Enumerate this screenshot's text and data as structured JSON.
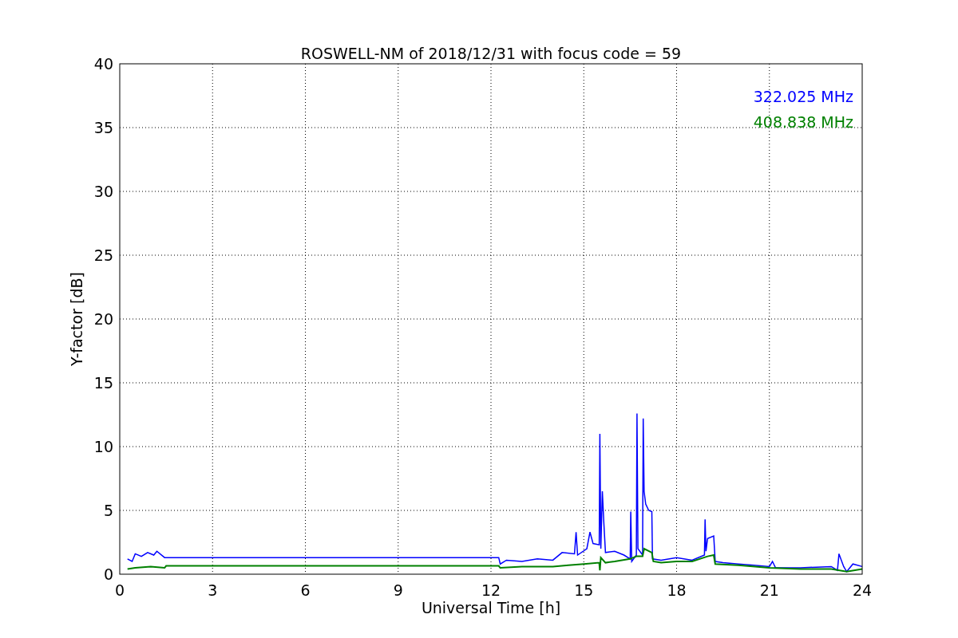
{
  "chart_data": {
    "type": "line",
    "title": "ROSWELL-NM of 2018/12/31 with focus code = 59",
    "xlabel": "Universal Time [h]",
    "ylabel": "Y-factor [dB]",
    "xlim": [
      0,
      24
    ],
    "ylim": [
      0,
      40
    ],
    "xticks": [
      0,
      3,
      6,
      9,
      12,
      15,
      18,
      21,
      24
    ],
    "yticks": [
      0,
      5,
      10,
      15,
      20,
      25,
      30,
      35,
      40
    ],
    "grid": true,
    "series": [
      {
        "name": "322.025 MHz",
        "color": "#0000ff",
        "x": [
          0.25,
          0.4,
          0.5,
          0.7,
          0.9,
          1.1,
          1.2,
          1.45,
          1.5,
          12.25,
          12.3,
          12.5,
          13,
          13.5,
          14,
          14.3,
          14.7,
          14.75,
          14.8,
          15.1,
          15.2,
          15.3,
          15.5,
          15.52,
          15.55,
          15.6,
          15.65,
          15.7,
          16,
          16.3,
          16.5,
          16.52,
          16.55,
          16.7,
          16.72,
          16.75,
          16.9,
          16.92,
          16.95,
          17,
          17.1,
          17.2,
          17.22,
          17.5,
          18,
          18.5,
          18.9,
          18.92,
          18.95,
          19,
          19.2,
          19.25,
          19.5,
          20,
          20.5,
          21,
          21.1,
          21.2,
          22,
          23,
          23.2,
          23.25,
          23.4,
          23.5,
          23.7,
          24
        ],
        "values": [
          1.2,
          1.0,
          1.6,
          1.4,
          1.7,
          1.5,
          1.8,
          1.3,
          1.3,
          1.3,
          0.8,
          1.1,
          1.0,
          1.2,
          1.1,
          1.7,
          1.6,
          3.3,
          1.5,
          2.0,
          3.3,
          2.4,
          2.3,
          11,
          2,
          6.5,
          4,
          1.7,
          1.8,
          1.5,
          1.2,
          4.9,
          1.0,
          1.5,
          12.6,
          2,
          1.5,
          12.2,
          6.5,
          5.5,
          5.0,
          4.9,
          1.2,
          1.1,
          1.3,
          1.1,
          1.5,
          4.3,
          1.8,
          2.8,
          3.0,
          1.0,
          0.9,
          0.8,
          0.7,
          0.6,
          1.0,
          0.5,
          0.5,
          0.6,
          0.3,
          1.6,
          0.6,
          0.2,
          0.8,
          0.6
        ]
      },
      {
        "name": "408.838 MHz",
        "color": "#008000",
        "x": [
          0.25,
          0.5,
          1.0,
          1.45,
          1.5,
          12.25,
          12.3,
          13,
          14,
          14.5,
          15,
          15.5,
          15.52,
          15.55,
          15.7,
          16,
          16.5,
          16.7,
          16.9,
          16.95,
          17.2,
          17.25,
          17.5,
          18,
          18.5,
          19,
          19.2,
          19.25,
          20,
          21,
          22,
          23,
          23.5,
          24
        ],
        "values": [
          0.4,
          0.5,
          0.6,
          0.5,
          0.65,
          0.65,
          0.5,
          0.6,
          0.6,
          0.7,
          0.8,
          0.9,
          0.3,
          1.3,
          0.9,
          1.0,
          1.2,
          1.4,
          1.4,
          2.0,
          1.7,
          1.0,
          0.9,
          1.0,
          1.0,
          1.4,
          1.5,
          0.8,
          0.7,
          0.5,
          0.4,
          0.4,
          0.2,
          0.4
        ]
      }
    ]
  }
}
